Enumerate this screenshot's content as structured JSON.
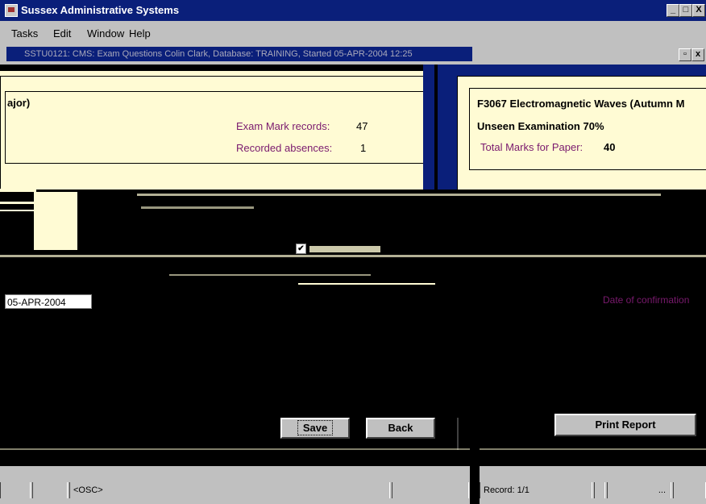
{
  "window": {
    "title": "Sussex Administrative Systems",
    "minimize": "_",
    "maximize": "□",
    "close": "X"
  },
  "menu": {
    "items": [
      "Tasks",
      "Edit",
      "Window",
      "Help"
    ]
  },
  "inner_window": {
    "title": "SSTU0121: CMS: Exam Questions Colin Clark, Database: TRAINING, Started 05-APR-2004 12:25"
  },
  "left_panel": {
    "heading": "ajor)",
    "exam_mark_label": "Exam Mark records:",
    "exam_mark_value": "47",
    "absences_label": "Recorded absences:",
    "absences_value": "1"
  },
  "right_panel": {
    "course": "F3067 Electromagnetic Waves (Autumn M",
    "exam_type": "Unseen Examination 70%",
    "total_label": "Total Marks for Paper:",
    "total_value": "40"
  },
  "form": {
    "checkbox_checked": true,
    "date_value": "05-APR-2004",
    "date_confirm_label": "Date of confirmation"
  },
  "buttons": {
    "save": "Save",
    "back": "Back",
    "print": "Print Report"
  },
  "status": {
    "module": "<OSC>",
    "record": "Record: 1/1",
    "ellipsis": "..."
  }
}
